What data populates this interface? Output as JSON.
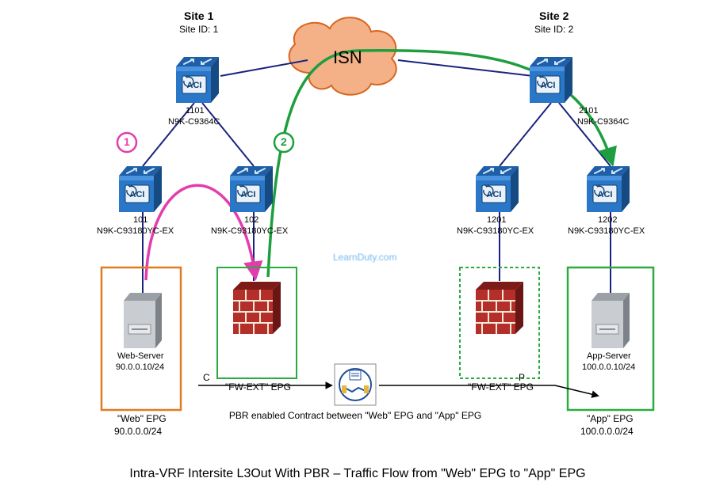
{
  "isn_label": "ISN",
  "badges": {
    "one": "1",
    "two": "2"
  },
  "sites": {
    "left": {
      "name": "Site 1",
      "id_label": "Site ID: 1"
    },
    "right": {
      "name": "Site 2",
      "id_label": "Site ID: 2"
    }
  },
  "spines": {
    "left": {
      "num": "1101",
      "model": "N9K-C9364C"
    },
    "right": {
      "num": "2101",
      "model": "N9K-C9364C"
    }
  },
  "leaves": {
    "l1": {
      "num": "101",
      "model": "N9K-C93180YC-EX"
    },
    "l2": {
      "num": "102",
      "model": "N9K-C93180YC-EX"
    },
    "r1": {
      "num": "1201",
      "model": "N9K-C93180YC-EX"
    },
    "r2": {
      "num": "1202",
      "model": "N9K-C93180YC-EX"
    }
  },
  "epgs": {
    "left_web": {
      "name": "\"Web\" EPG",
      "subnet": "90.0.0.0/24"
    },
    "left_fw": {
      "name": "\"FW-EXT\" EPG"
    },
    "right_fw": {
      "name": "\"FW-EXT\" EPG"
    },
    "right_app": {
      "name": "\"App\" EPG",
      "subnet": "100.0.0.0/24"
    }
  },
  "servers": {
    "web": {
      "name": "Web-Server",
      "ip": "90.0.0.10/24"
    },
    "app": {
      "name": "App-Server",
      "ip": "100.0.0.10/24"
    }
  },
  "contract": {
    "c_label": "C",
    "p_label": "P",
    "caption": "PBR enabled Contract between \"Web\" EPG and \"App\" EPG"
  },
  "watermark": "LearnDuty.com",
  "footer": "Intra-VRF Intersite L3Out With PBR – Traffic Flow from \"Web\" EPG to \"App\" EPG"
}
